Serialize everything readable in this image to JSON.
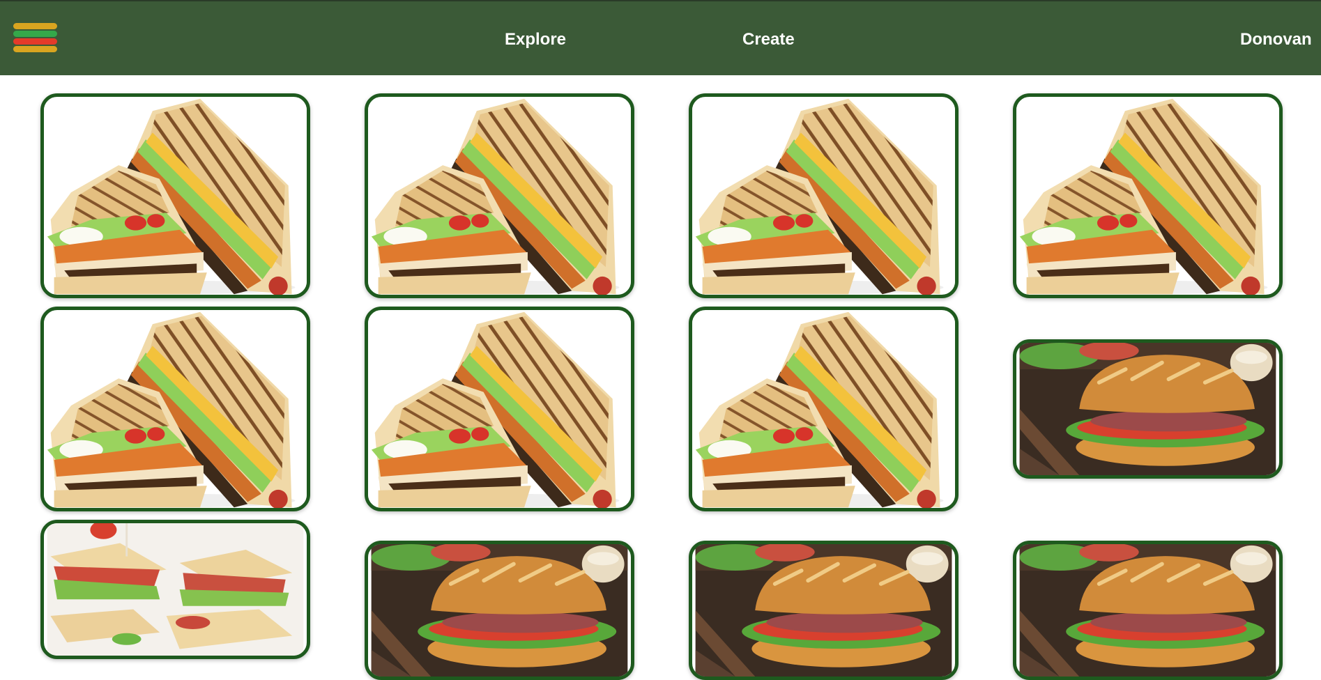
{
  "header": {
    "menu_icon": "hamburger-sandwich-icon",
    "menu_colors": [
      "#d9a520",
      "#34a84a",
      "#e43a2a",
      "#d9a520"
    ],
    "nav": [
      {
        "label": "Explore"
      },
      {
        "label": "Create"
      }
    ],
    "user_name": "Donovan"
  },
  "theme": {
    "navbar_bg": "#3b5a37",
    "card_border": "#1e5a1e"
  },
  "grid": {
    "cards": [
      {
        "image": "grilled-panini-sandwich"
      },
      {
        "image": "grilled-panini-sandwich"
      },
      {
        "image": "grilled-panini-sandwich"
      },
      {
        "image": "grilled-panini-sandwich"
      },
      {
        "image": "grilled-panini-sandwich"
      },
      {
        "image": "grilled-panini-sandwich"
      },
      {
        "image": "grilled-panini-sandwich"
      },
      {
        "image": "baguette-sub-sandwich"
      },
      {
        "image": "club-sandwich-platter"
      },
      {
        "image": "baguette-sub-sandwich"
      },
      {
        "image": "baguette-sub-sandwich"
      },
      {
        "image": "baguette-sub-sandwich"
      }
    ]
  }
}
